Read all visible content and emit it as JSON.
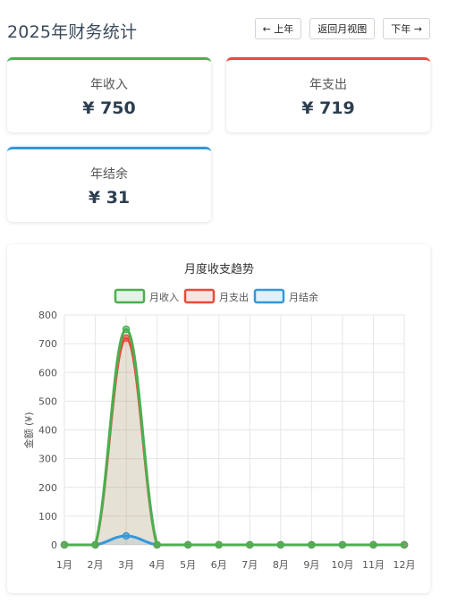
{
  "header": {
    "title": "2025年财务统计",
    "prev_label": "← 上年",
    "month_view_label": "返回月视图",
    "next_label": "下年 →"
  },
  "summary": {
    "income": {
      "label": "年收入",
      "value": "¥ 750"
    },
    "expense": {
      "label": "年支出",
      "value": "¥ 719"
    },
    "balance": {
      "label": "年结余",
      "value": "¥ 31"
    }
  },
  "colors": {
    "income": "#4caf50",
    "expense": "#e74c3c",
    "balance": "#3498db"
  },
  "chart_data": {
    "type": "line",
    "title": "月度收支趋势",
    "ylabel": "金额 (¥)",
    "xlabel": "",
    "categories": [
      "1月",
      "2月",
      "3月",
      "4月",
      "5月",
      "6月",
      "7月",
      "8月",
      "9月",
      "10月",
      "11月",
      "12月"
    ],
    "ylim": [
      0,
      800
    ],
    "yticks": [
      0,
      100,
      200,
      300,
      400,
      500,
      600,
      700,
      800
    ],
    "grid": true,
    "legend": "top",
    "series": [
      {
        "name": "月收入",
        "color": "#4caf50",
        "values": [
          0,
          0,
          750,
          0,
          0,
          0,
          0,
          0,
          0,
          0,
          0,
          0
        ]
      },
      {
        "name": "月支出",
        "color": "#e74c3c",
        "values": [
          0,
          0,
          719,
          0,
          0,
          0,
          0,
          0,
          0,
          0,
          0,
          0
        ]
      },
      {
        "name": "月结余",
        "color": "#3498db",
        "values": [
          0,
          0,
          31,
          0,
          0,
          0,
          0,
          0,
          0,
          0,
          0,
          0
        ]
      }
    ]
  }
}
